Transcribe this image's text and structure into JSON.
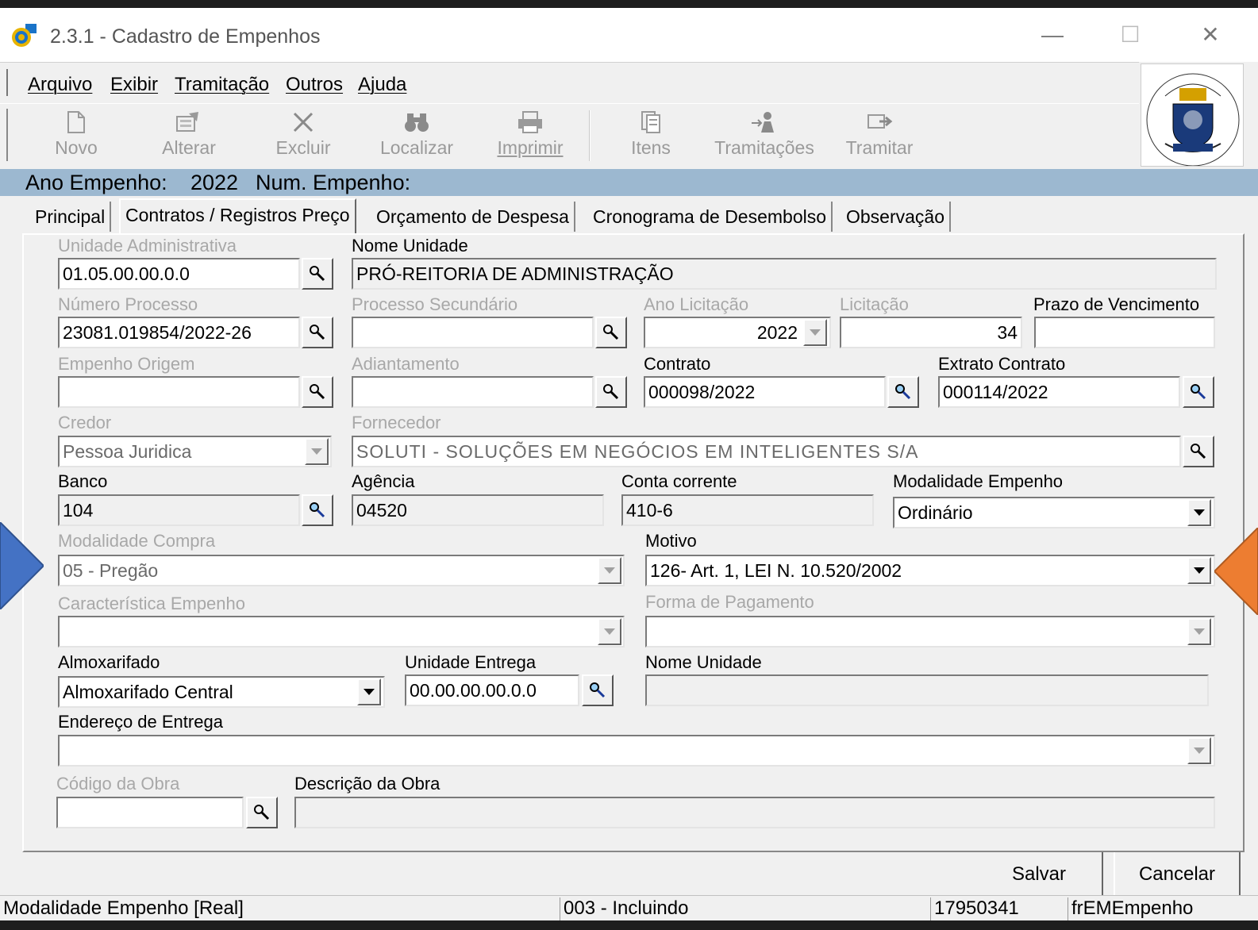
{
  "window": {
    "title": "2.3.1 - Cadastro de Empenhos",
    "controls": {
      "minimize": "—",
      "maximize": "☐",
      "close": "✕"
    }
  },
  "menu": [
    "Arquivo",
    "Exibir",
    "Tramitação",
    "Outros",
    "Ajuda"
  ],
  "toolbar": {
    "novo": "Novo",
    "alterar": "Alterar",
    "excluir": "Excluir",
    "localizar": "Localizar",
    "imprimir": "Imprimir",
    "itens": "Itens",
    "tramitacoes": "Tramitações",
    "tramitar": "Tramitar"
  },
  "info": {
    "ano_label": "Ano Empenho:",
    "ano_value": "2022",
    "num_label": "Num. Empenho:"
  },
  "tabs": [
    "Principal",
    "Contratos / Registros Preço",
    "Orçamento de Despesa",
    "Cronograma de Desembolso",
    "Observação"
  ],
  "form": {
    "unidade_adm": {
      "label": "Unidade Administrativa",
      "value": "01.05.00.00.0.0"
    },
    "nome_unidade": {
      "label": "Nome Unidade",
      "value": "PRÓ-REITORIA DE ADMINISTRAÇÃO"
    },
    "numero_processo": {
      "label": "Número Processo",
      "value": "23081.019854/2022-26"
    },
    "processo_secundario": {
      "label": "Processo Secundário",
      "value": ""
    },
    "ano_licitacao": {
      "label": "Ano Licitação",
      "value": "2022"
    },
    "licitacao": {
      "label": "Licitação",
      "value": "34"
    },
    "prazo_vencimento": {
      "label": "Prazo de Vencimento",
      "value": ""
    },
    "empenho_origem": {
      "label": "Empenho Origem",
      "value": ""
    },
    "adiantamento": {
      "label": "Adiantamento",
      "value": ""
    },
    "contrato": {
      "label": "Contrato",
      "value": "000098/2022"
    },
    "extrato_contrato": {
      "label": "Extrato Contrato",
      "value": "000114/2022"
    },
    "credor": {
      "label": "Credor",
      "value": "Pessoa Juridica"
    },
    "fornecedor": {
      "label": "Fornecedor",
      "value": "SOLUTI - SOLUÇÕES EM NEGÓCIOS EM INTELIGENTES S/A"
    },
    "banco": {
      "label": "Banco",
      "value": "104"
    },
    "agencia": {
      "label": "Agência",
      "value": "04520"
    },
    "conta_corrente": {
      "label": "Conta corrente",
      "value": "410-6"
    },
    "modalidade_empenho": {
      "label": "Modalidade Empenho",
      "value": "Ordinário"
    },
    "modalidade_compra": {
      "label": "Modalidade Compra",
      "value": "05 - Pregão"
    },
    "motivo": {
      "label": "Motivo",
      "value": "126- Art. 1, LEI N. 10.520/2002"
    },
    "caracteristica_empenho": {
      "label": "Característica Empenho",
      "value": ""
    },
    "forma_pagamento": {
      "label": "Forma de Pagamento",
      "value": ""
    },
    "almoxarifado": {
      "label": "Almoxarifado",
      "value": "Almoxarifado Central"
    },
    "unidade_entrega": {
      "label": "Unidade Entrega",
      "value": "00.00.00.00.0.0"
    },
    "nome_unidade_entrega": {
      "label": "Nome Unidade",
      "value": ""
    },
    "endereco_entrega": {
      "label": "Endereço de Entrega",
      "value": ""
    },
    "codigo_obra": {
      "label": "Código da Obra",
      "value": ""
    },
    "descricao_obra": {
      "label": "Descrição da Obra",
      "value": ""
    }
  },
  "actions": {
    "salvar": "Salvar",
    "cancelar": "Cancelar"
  },
  "status": {
    "field": "Modalidade Empenho [Real]",
    "mode": "003 - Incluindo",
    "id": "17950341",
    "form": "frEMEmpenho"
  },
  "colors": {
    "info_bar": "#9cb8d0",
    "arrow_left": "#4472c4",
    "arrow_right": "#ed7d31"
  },
  "icons": [
    "app-icon",
    "magnifier-icon",
    "university-logo"
  ]
}
